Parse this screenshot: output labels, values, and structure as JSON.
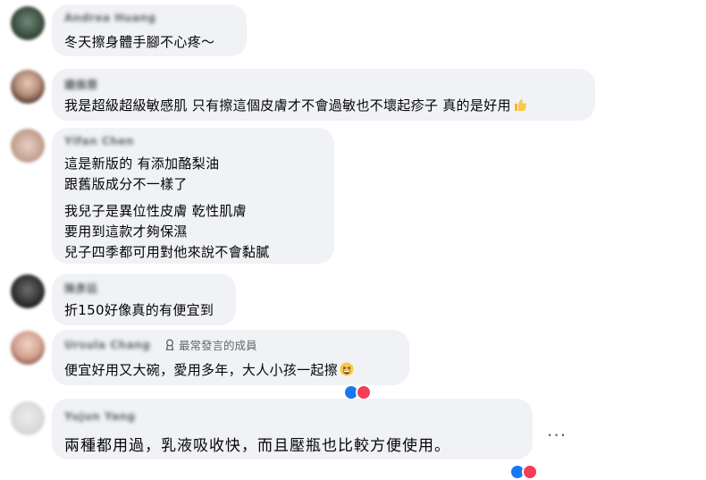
{
  "comments": [
    {
      "author": "Andrea Huang",
      "lines": [
        "冬天擦身體手腳不心疼～"
      ]
    },
    {
      "author": "鍾佩蓉",
      "lines": [
        "我是超級超級敏感肌 只有擦這個皮膚才不會過敏也不壞起疹子 真的是好用"
      ],
      "emoji": "thumbs-up"
    },
    {
      "author": "Yifan Chen",
      "lines": [
        "這是新版的 有添加酪梨油",
        "跟舊版成分不一樣了",
        "我兒子是異位性皮膚 乾性肌膚",
        "要用到這款才夠保濕",
        "兒子四季都可用對他來說不會黏膩"
      ]
    },
    {
      "author": "陳彥廷",
      "lines": [
        "折150好像真的有便宜到"
      ]
    },
    {
      "author": "Ursula Chang",
      "badge": "最常發言的成員",
      "lines": [
        "便宜好用又大碗，愛用多年，大人小孩一起擦"
      ],
      "emoji": "grinning-squinting-face"
    },
    {
      "author": "Yujun Yang",
      "lines": [
        "兩種都用過，乳液吸收快，而且壓瓶也比較方便使用。"
      ]
    }
  ],
  "more_options": "···",
  "colors": {
    "bubble": "#f0f2f5",
    "name": "#65676b",
    "text": "#050505",
    "like_blue": "#1877f2",
    "love_red": "#f33e58"
  }
}
